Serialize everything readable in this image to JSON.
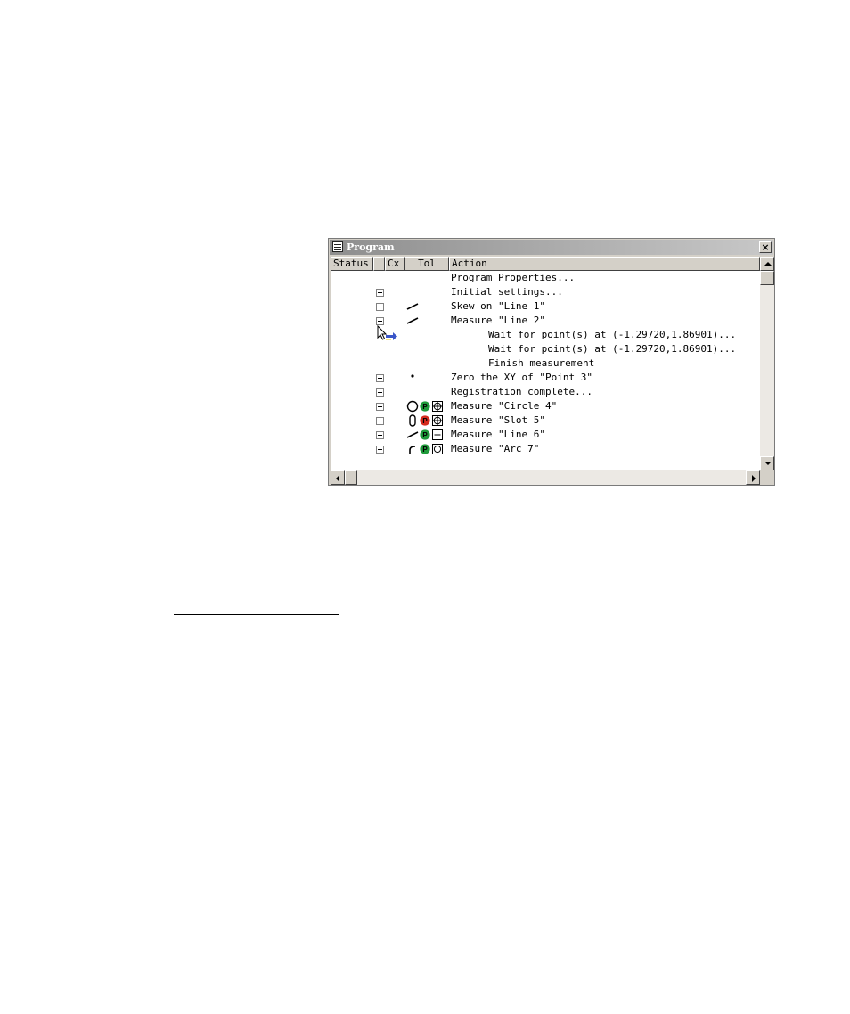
{
  "window": {
    "title": "Program",
    "close_glyph": "×"
  },
  "columns": [
    {
      "label": "Status"
    },
    {
      "label": ""
    },
    {
      "label": "Cx"
    },
    {
      "label": "Tol"
    },
    {
      "label": "Action"
    }
  ],
  "rows": [
    {
      "action": "Program Properties...",
      "expander": "none",
      "feature_icon": "",
      "tol_icons": []
    },
    {
      "action": "Initial settings...",
      "expander": "plus",
      "feature_icon": "",
      "tol_icons": []
    },
    {
      "action": "Skew on \"Line 1\"",
      "expander": "plus",
      "feature_icon": "line-icon",
      "tol_icons": []
    },
    {
      "action": "Measure \"Line 2\"",
      "expander": "minus",
      "feature_icon": "line-icon",
      "tol_icons": []
    },
    {
      "action": "Wait for point(s) at (-1.29720,1.86901)...",
      "expander": "none",
      "feature_icon": "",
      "tol_icons": [],
      "child": true
    },
    {
      "action": "Wait for point(s) at (-1.29720,1.86901)...",
      "expander": "none",
      "feature_icon": "",
      "tol_icons": [],
      "child": true
    },
    {
      "action": "Finish measurement",
      "expander": "none",
      "feature_icon": "",
      "tol_icons": [],
      "child": true
    },
    {
      "action": "Zero the XY of \"Point 3\"",
      "expander": "plus",
      "feature_icon": "point-icon",
      "tol_icons": []
    },
    {
      "action": "Registration complete...",
      "expander": "plus",
      "feature_icon": "",
      "tol_icons": []
    },
    {
      "action": "Measure \"Circle 4\"",
      "expander": "plus",
      "feature_icon": "circle-icon",
      "tol_icons": [
        "pass-green-icon",
        "position-tolerance-icon"
      ]
    },
    {
      "action": "Measure \"Slot 5\"",
      "expander": "plus",
      "feature_icon": "slot-icon",
      "tol_icons": [
        "fail-red-icon",
        "position-tolerance-icon"
      ]
    },
    {
      "action": "Measure \"Line 6\"",
      "expander": "plus",
      "feature_icon": "line-icon",
      "tol_icons": [
        "pass-green-icon",
        "straightness-tolerance-icon"
      ]
    },
    {
      "action": "Measure \"Arc 7\"",
      "expander": "plus",
      "feature_icon": "arc-icon",
      "tol_icons": [
        "pass-green-icon",
        "circularity-tolerance-icon"
      ]
    }
  ],
  "tol_letter": "P",
  "colors": {
    "pass": "#1f9a3a",
    "fail": "#d42a1d",
    "current_arrow": "#3a56c8",
    "title_gradient_start": "#8e8e8e"
  }
}
